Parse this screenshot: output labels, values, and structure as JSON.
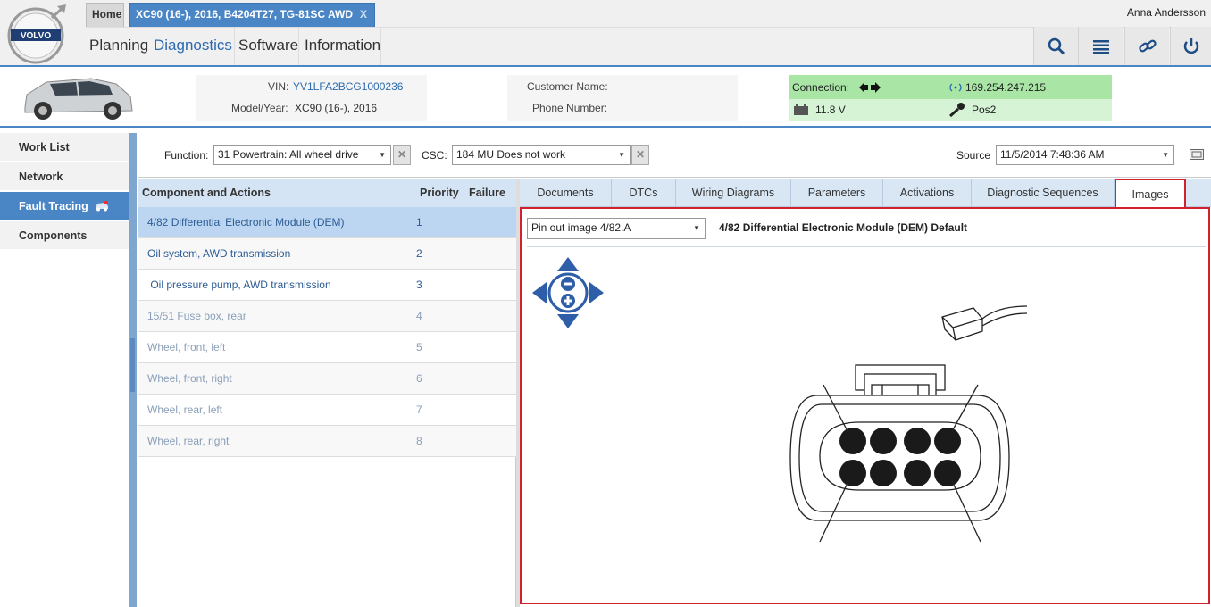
{
  "header": {
    "tabs": [
      {
        "label": "Home"
      },
      {
        "label": "XC90 (16-), 2016, B4204T27, TG-81SC AWD",
        "close": "X"
      }
    ],
    "menu": [
      "Planning",
      "Diagnostics",
      "Software",
      "Information"
    ],
    "active_menu": "Diagnostics",
    "user": "Anna Andersson",
    "toolbar_icons": [
      "search-icon",
      "list-icon",
      "link-icon",
      "power-icon"
    ]
  },
  "vehicle": {
    "vin_label": "VIN:",
    "vin": "YV1LFA2BCG1000236",
    "model_label": "Model/Year:",
    "model": "XC90 (16-), 2016",
    "customer_label": "Customer Name:",
    "phone_label": "Phone Number:",
    "connection_label": "Connection:",
    "ip": "169.254.247.215",
    "voltage": "11.8 V",
    "ignition": "Pos2"
  },
  "nav": {
    "items": [
      "Work List",
      "Network",
      "Fault Tracing",
      "Components"
    ],
    "active": "Fault Tracing"
  },
  "filters": {
    "function_label": "Function:",
    "function_value": "31 Powertrain: All wheel drive",
    "csc_label": "CSC:",
    "csc_value": "184 MU Does not work",
    "source_label": "Source",
    "source_value": "11/5/2014 7:48:36 AM"
  },
  "components": {
    "headers": {
      "name": "Component and Actions",
      "priority": "Priority",
      "failure": "Failure"
    },
    "rows": [
      {
        "name": "4/82 Differential Electronic Module (DEM)",
        "priority": "1"
      },
      {
        "name": "Oil system, AWD transmission",
        "priority": "2"
      },
      {
        "name": " Oil pressure pump, AWD transmission",
        "priority": "3"
      },
      {
        "name": "15/51 Fuse box, rear",
        "priority": "4"
      },
      {
        "name": "Wheel, front, left",
        "priority": "5"
      },
      {
        "name": "Wheel, front, right",
        "priority": "6"
      },
      {
        "name": "Wheel, rear, left",
        "priority": "7"
      },
      {
        "name": "Wheel, rear, right",
        "priority": "8"
      }
    ]
  },
  "detail_tabs": [
    "Documents",
    "DTCs",
    "Wiring Diagrams",
    "Parameters",
    "Activations",
    "Diagnostic Sequences",
    "Images"
  ],
  "active_detail_tab": "Images",
  "image_view": {
    "image_select": "Pin out image 4/82.A",
    "image_title": "4/82 Differential Electronic Module (DEM) Default"
  },
  "colors": {
    "accent": "#4a86c5",
    "highlight": "#d1202e",
    "connection": "#a9e6a6"
  }
}
